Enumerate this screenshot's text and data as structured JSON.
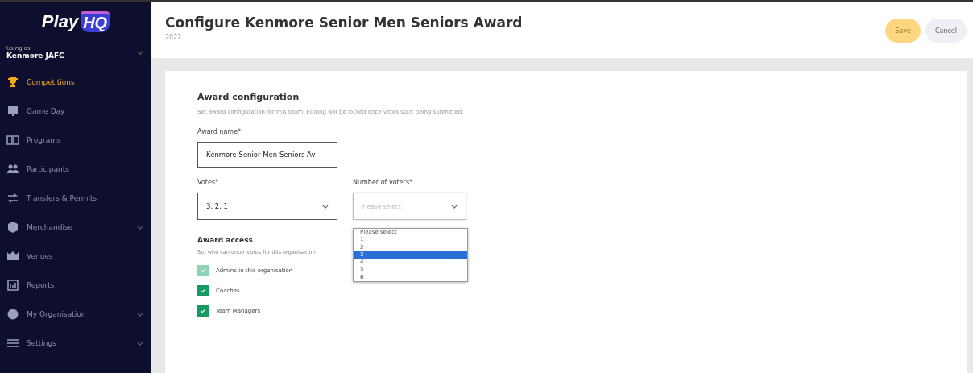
{
  "sidebar": {
    "logo": "Play",
    "logo_badge": "HQ",
    "using_as_label": "Using as",
    "organisation": "Kenmore JAFC",
    "items": [
      {
        "label": "Competitions",
        "selected": true,
        "has_submenu": false
      },
      {
        "label": "Game Day",
        "selected": false,
        "has_submenu": false
      },
      {
        "label": "Programs",
        "selected": false,
        "has_submenu": false
      },
      {
        "label": "Participants",
        "selected": false,
        "has_submenu": false
      },
      {
        "label": "Transfers & Permits",
        "selected": false,
        "has_submenu": false
      },
      {
        "label": "Merchandise",
        "selected": false,
        "has_submenu": true
      },
      {
        "label": "Venues",
        "selected": false,
        "has_submenu": false
      },
      {
        "label": "Reports",
        "selected": false,
        "has_submenu": false
      },
      {
        "label": "My Organisation",
        "selected": false,
        "has_submenu": true
      },
      {
        "label": "Settings",
        "selected": false,
        "has_submenu": true
      }
    ]
  },
  "header": {
    "title": "Configure Kenmore Senior Men Seniors Award",
    "subtitle": "2022",
    "buttons": [
      {
        "label": "Save",
        "kind": "primary",
        "disabled": true
      },
      {
        "label": "Cancel",
        "kind": "secondary",
        "disabled": false
      }
    ]
  },
  "form": {
    "section_title": "Award configuration",
    "section_description": "Set award configuration for this team. Editing will be locked once votes start being submitted.",
    "award_name": {
      "label": "Award name*",
      "value": "Kenmore Senior Men Seniors Av"
    },
    "votes": {
      "label": "Votes*",
      "value": "3, 2, 1"
    },
    "number_of_voters": {
      "label": "Number of voters*",
      "placeholder": "Please select",
      "expanded": true,
      "options": [
        {
          "label": "Please select",
          "selected": false
        },
        {
          "label": "1",
          "selected": false
        },
        {
          "label": "2",
          "selected": false
        },
        {
          "label": "3",
          "selected": true
        },
        {
          "label": "4",
          "selected": false
        },
        {
          "label": "5",
          "selected": false
        },
        {
          "label": "6",
          "selected": false
        }
      ]
    },
    "access_title": "Award access",
    "access_description": "Set who can enter votes for this organisation",
    "access_options": [
      {
        "label": "Admins in this organisation",
        "checked": true,
        "disabled": true
      },
      {
        "label": "Coaches",
        "checked": true,
        "disabled": false
      },
      {
        "label": "Team Managers",
        "checked": true,
        "disabled": false
      }
    ]
  }
}
